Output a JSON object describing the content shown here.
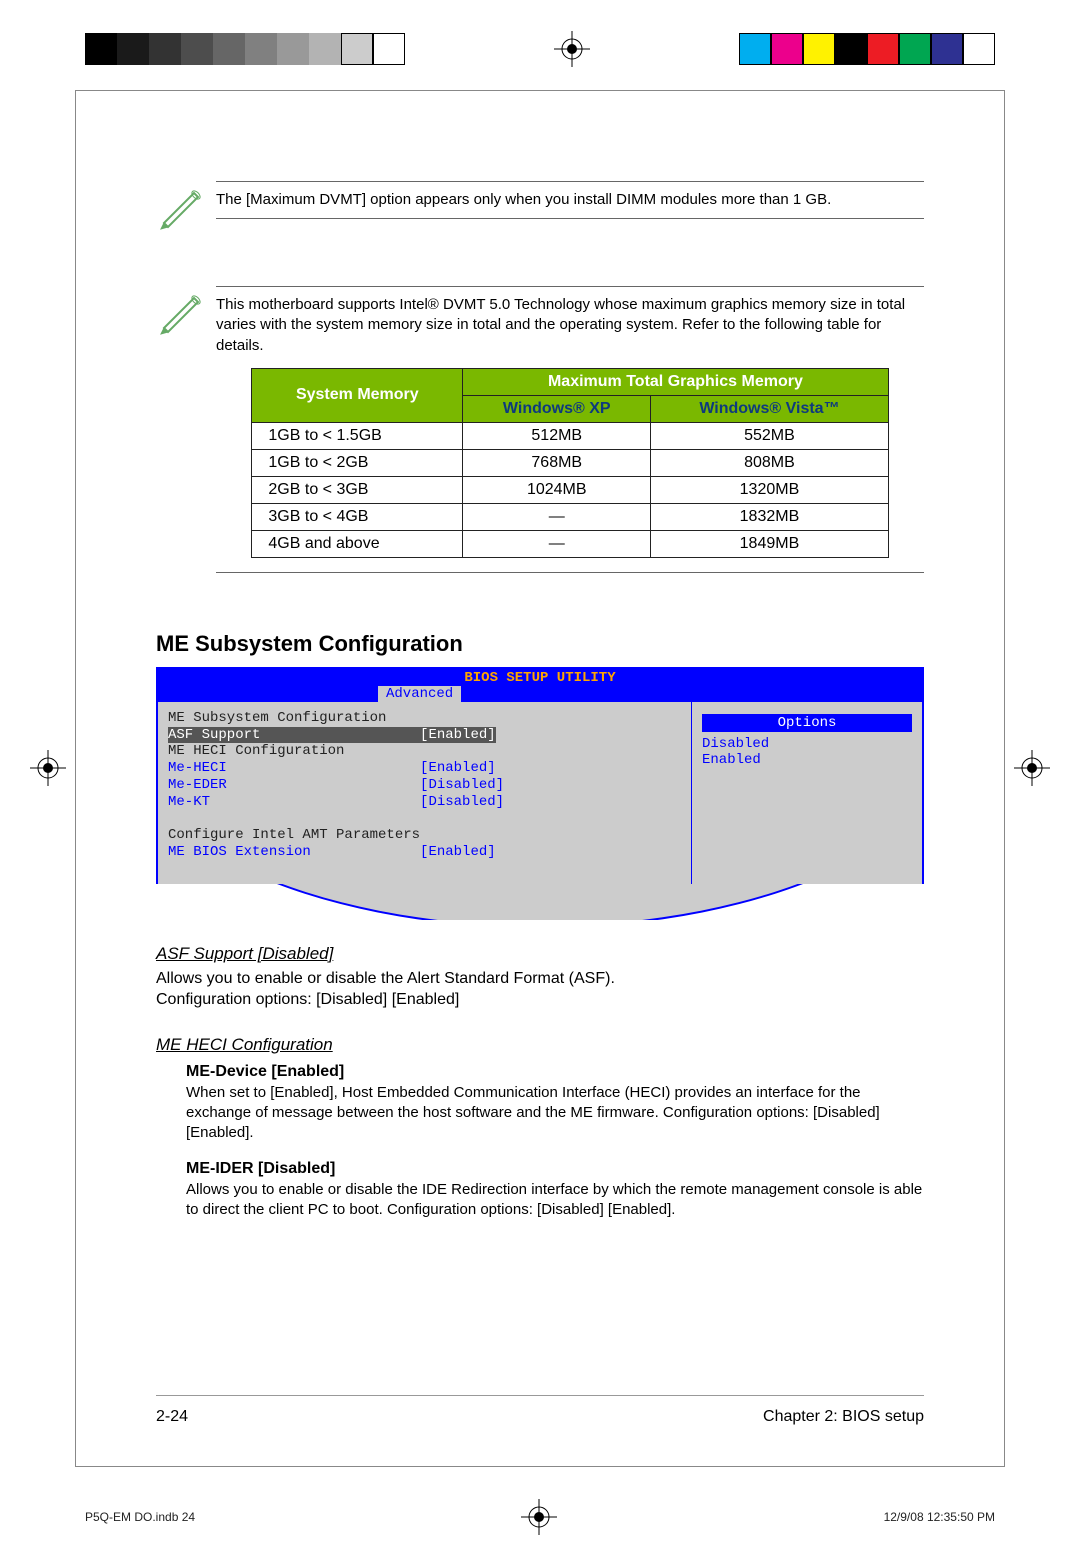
{
  "cropMarks": {
    "grayscale": [
      "#000",
      "#222",
      "#444",
      "#666",
      "#888",
      "#aaa",
      "#ccc",
      "#eee",
      "#fff",
      "#fff"
    ],
    "colors": [
      "#00aeef",
      "#ec008c",
      "#fff200",
      "#000000",
      "#ed1c24",
      "#00a651",
      "#2e3192",
      "#ffffff"
    ]
  },
  "note1": "The [Maximum DVMT] option appears only when you install DIMM modules more than 1 GB.",
  "note2": "This motherboard supports Intel® DVMT 5.0 Technology whose maximum graphics memory size in total varies with the system memory size in total and the operating system. Refer to the following table for details.",
  "memTable": {
    "headers": {
      "sysMem": "System Memory",
      "maxGraphics": "Maximum Total Graphics Memory",
      "winXP": "Windows® XP",
      "winVista": "Windows® Vista™"
    },
    "rows": [
      {
        "sys": "1GB to < 1.5GB",
        "xp": "512MB",
        "vista": "552MB"
      },
      {
        "sys": "1GB to < 2GB",
        "xp": "768MB",
        "vista": "808MB"
      },
      {
        "sys": "2GB to < 3GB",
        "xp": "1024MB",
        "vista": "1320MB"
      },
      {
        "sys": "3GB to < 4GB",
        "xp": "—",
        "vista": "1832MB"
      },
      {
        "sys": "4GB and above",
        "xp": "—",
        "vista": "1849MB"
      }
    ]
  },
  "sectionHeading": "ME Subsystem Configuration",
  "bios": {
    "title": "BIOS SETUP UTILITY",
    "tab": "Advanced",
    "heading": "ME Subsystem Configuration",
    "items": [
      {
        "label": "ASF Support",
        "value": "[Enabled]",
        "selected": true
      },
      {
        "label": "ME HECI Configuration",
        "value": "",
        "header": true
      },
      {
        "label": "Me-HECI",
        "value": "[Enabled]"
      },
      {
        "label": "Me-EDER",
        "value": "[Disabled]"
      },
      {
        "label": "Me-KT",
        "value": "[Disabled]"
      },
      {
        "label": "Configure Intel AMT Parameters",
        "value": "",
        "header": true
      },
      {
        "label": "ME BIOS Extension",
        "value": "[Enabled]"
      }
    ],
    "optionsHeader": "Options",
    "options": [
      "Disabled",
      "Enabled"
    ]
  },
  "asf": {
    "heading": "ASF Support [Disabled]",
    "body": "Allows you to enable or disable the Alert Standard Format (ASF).\nConfiguration options: [Disabled] [Enabled]"
  },
  "heci": {
    "heading": "ME HECI Configuration",
    "meDevice": {
      "title": "ME-Device [Enabled]",
      "body": "When set to [Enabled], Host Embedded Communication Interface (HECI) provides an interface for the exchange of message between the host software and the ME firmware. Configuration options: [Disabled] [Enabled]."
    },
    "meIder": {
      "title": "ME-IDER [Disabled]",
      "body": "Allows you to enable or disable the IDE Redirection interface by which the remote management console is able to direct the client PC to boot. Configuration options: [Disabled] [Enabled]."
    }
  },
  "footer": {
    "pageNum": "2-24",
    "chapter": "Chapter 2: BIOS setup"
  },
  "printFooter": {
    "file": "P5Q-EM DO.indb   24",
    "timestamp": "12/9/08   12:35:50 PM"
  }
}
